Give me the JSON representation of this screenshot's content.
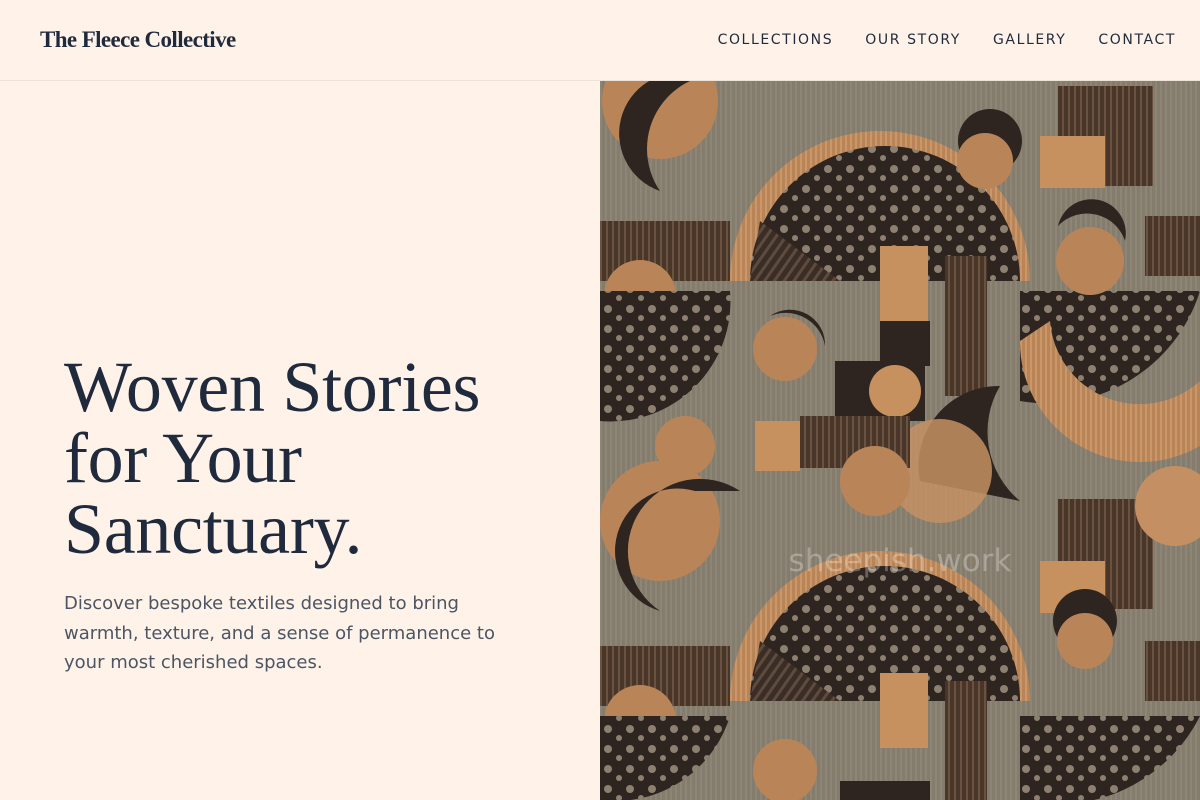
{
  "header": {
    "logo": "The Fleece Collective",
    "nav": [
      "COLLECTIONS",
      "OUR STORY",
      "GALLERY",
      "CONTACT"
    ]
  },
  "hero": {
    "headline_lines": [
      "Woven Stories",
      "for Your",
      "Sanctuary."
    ],
    "subtext": "Discover bespoke textiles designed to bring warmth, texture, and a sense of permanence to your most cherished spaces."
  },
  "image": {
    "watermark": "sheepish.work"
  },
  "colors": {
    "background": "#fff3e9",
    "ink": "#1f2a3d",
    "muted": "#4b5563",
    "fabric_base": "#7e7668",
    "fabric_orange": "#b98558",
    "fabric_dark": "#2f2520",
    "fabric_brown": "#5a4434"
  }
}
